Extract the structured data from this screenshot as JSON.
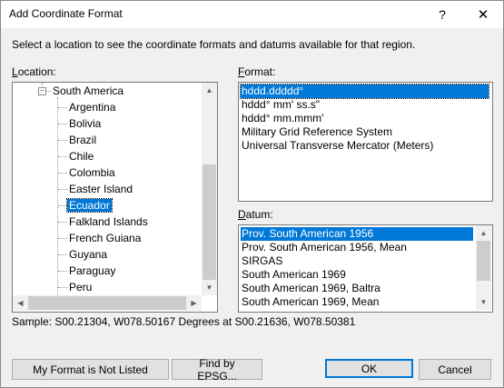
{
  "window": {
    "title": "Add Coordinate Format",
    "help_glyph": "?",
    "close_glyph": "✕"
  },
  "instruction": "Select a location to see the coordinate formats and datums available for that region.",
  "location": {
    "label_underlined": "L",
    "label_rest": "ocation:",
    "parent": "South America",
    "parent_expander": "−",
    "items": [
      "Argentina",
      "Bolivia",
      "Brazil",
      "Chile",
      "Colombia",
      "Easter Island",
      "Ecuador",
      "Falkland Islands",
      "French Guiana",
      "Guyana",
      "Paraguay",
      "Peru"
    ],
    "selected": "Ecuador"
  },
  "format": {
    "label_underlined": "F",
    "label_rest": "ormat:",
    "items": [
      "hddd.ddddd°",
      "hddd° mm' ss.s\"",
      "hddd° mm.mmm'",
      "Military Grid Reference System",
      "Universal Transverse Mercator (Meters)"
    ],
    "selected": "hddd.ddddd°"
  },
  "datum": {
    "label_underlined": "D",
    "label_rest": "atum:",
    "items": [
      "Prov. South American 1956",
      "Prov. South American 1956, Mean",
      "SIRGAS",
      "South American 1969",
      "South American 1969, Baltra",
      "South American 1969, Mean"
    ],
    "selected": "Prov. South American 1956"
  },
  "sample": "Sample: S00.21304, W078.50167 Degrees at S00.21636, W078.50381",
  "buttons": {
    "not_listed": "My Format is Not Listed",
    "epsg": "Find by EPSG...",
    "ok": "OK",
    "cancel": "Cancel"
  },
  "scroll_glyphs": {
    "up": "▲",
    "down": "▼",
    "left": "◀",
    "right": "▶"
  }
}
